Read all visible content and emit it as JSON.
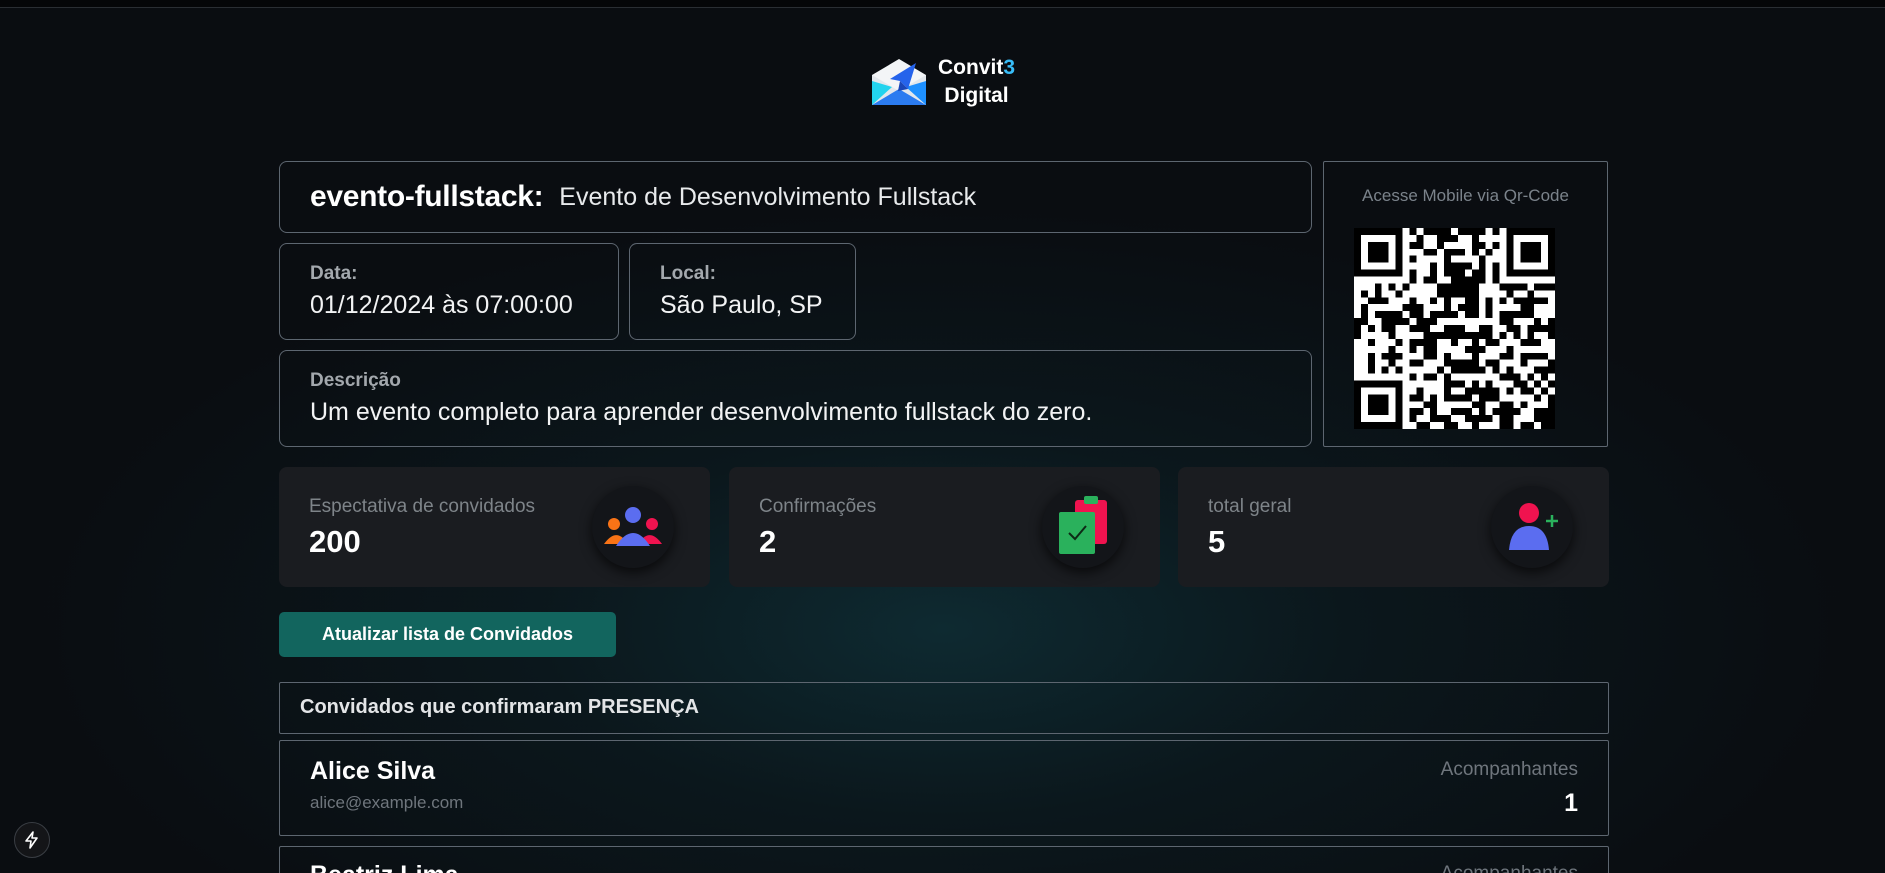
{
  "logo": {
    "line1_a": "Convit",
    "line1_b": "3",
    "line2": "Digital"
  },
  "event": {
    "slug": "evento-fullstack:",
    "name": "Evento de Desenvolvimento Fullstack",
    "date_label": "Data:",
    "date_value": "01/12/2024 às 07:00:00",
    "local_label": "Local:",
    "local_value": "São Paulo, SP",
    "desc_label": "Descrição",
    "desc_value": "Um evento completo para aprender desenvolvimento fullstack do zero."
  },
  "qr": {
    "label": "Acesse Mobile via Qr-Code"
  },
  "stats": [
    {
      "label": "Espectativa de convidados",
      "value": "200",
      "icon": "group-icon"
    },
    {
      "label": "Confirmações",
      "value": "2",
      "icon": "clipboard-check-icon"
    },
    {
      "label": "total geral",
      "value": "5",
      "icon": "add-user-icon"
    }
  ],
  "actions": {
    "update_label": "Atualizar lista de Convidados"
  },
  "guests_section": {
    "title": "Convidados que confirmaram PRESENÇA",
    "companions_label": "Acompanhantes",
    "guests": [
      {
        "name": "Alice Silva",
        "email": "alice@example.com",
        "companions": "1"
      },
      {
        "name": "Beatriz Lima"
      }
    ]
  },
  "colors": {
    "accent": "#12655e",
    "qr_link": "#38bdf8",
    "icon_blue": "#5b6df0",
    "icon_red": "#f0134f",
    "icon_green": "#2ab15c"
  }
}
